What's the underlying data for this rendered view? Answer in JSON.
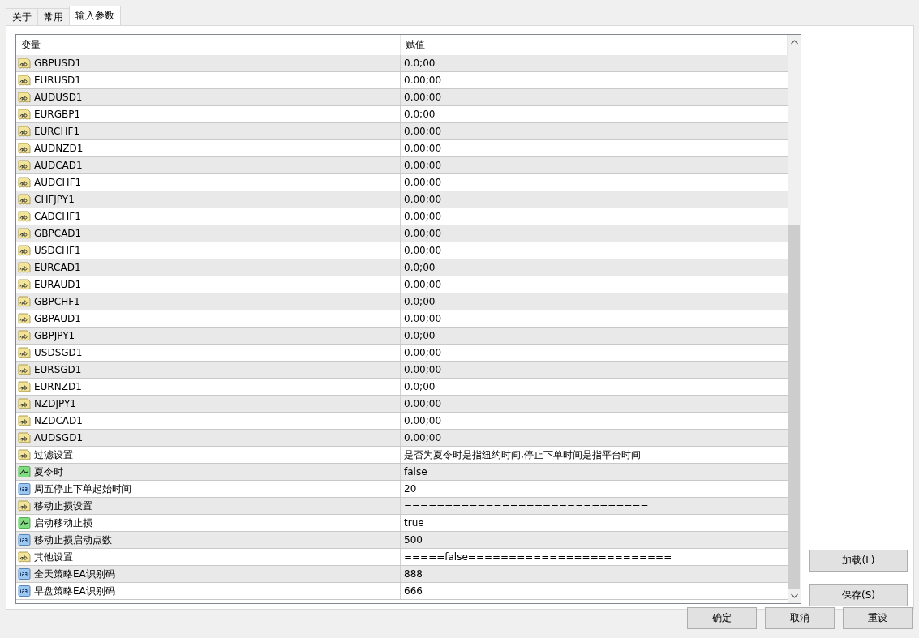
{
  "tabs": [
    {
      "label": "关于",
      "selected": false
    },
    {
      "label": "常用",
      "selected": false
    },
    {
      "label": "输入参数",
      "selected": true
    }
  ],
  "table": {
    "columns": [
      "变量",
      "赋值"
    ],
    "rows": [
      {
        "kind": "string",
        "name": "GBPUSD1",
        "value": "0.0;00"
      },
      {
        "kind": "string",
        "name": "EURUSD1",
        "value": "0.00;00"
      },
      {
        "kind": "string",
        "name": "AUDUSD1",
        "value": "0.00;00"
      },
      {
        "kind": "string",
        "name": "EURGBP1",
        "value": "0.0;00"
      },
      {
        "kind": "string",
        "name": "EURCHF1",
        "value": "0.00;00"
      },
      {
        "kind": "string",
        "name": "AUDNZD1",
        "value": "0.00;00"
      },
      {
        "kind": "string",
        "name": "AUDCAD1",
        "value": "0.00;00"
      },
      {
        "kind": "string",
        "name": "AUDCHF1",
        "value": "0.00;00"
      },
      {
        "kind": "string",
        "name": "CHFJPY1",
        "value": "0.00;00"
      },
      {
        "kind": "string",
        "name": "CADCHF1",
        "value": "0.00;00"
      },
      {
        "kind": "string",
        "name": "GBPCAD1",
        "value": "0.00;00"
      },
      {
        "kind": "string",
        "name": "USDCHF1",
        "value": "0.00;00"
      },
      {
        "kind": "string",
        "name": "EURCAD1",
        "value": "0.0;00"
      },
      {
        "kind": "string",
        "name": "EURAUD1",
        "value": "0.00;00"
      },
      {
        "kind": "string",
        "name": "GBPCHF1",
        "value": "0.0;00"
      },
      {
        "kind": "string",
        "name": "GBPAUD1",
        "value": "0.00;00"
      },
      {
        "kind": "string",
        "name": "GBPJPY1",
        "value": "0.0;00"
      },
      {
        "kind": "string",
        "name": "USDSGD1",
        "value": "0.00;00"
      },
      {
        "kind": "string",
        "name": "EURSGD1",
        "value": "0.00;00"
      },
      {
        "kind": "string",
        "name": "EURNZD1",
        "value": "0.0;00"
      },
      {
        "kind": "string",
        "name": "NZDJPY1",
        "value": "0.00;00"
      },
      {
        "kind": "string",
        "name": "NZDCAD1",
        "value": "0.00;00"
      },
      {
        "kind": "string",
        "name": "AUDSGD1",
        "value": "0.00;00"
      },
      {
        "kind": "string",
        "name": "过滤设置",
        "value": "是否为夏令时是指纽约时间,停止下单时间是指平台时间"
      },
      {
        "kind": "bool",
        "name": "夏令时",
        "value": "false"
      },
      {
        "kind": "int",
        "name": "周五停止下单起始时间",
        "value": "20"
      },
      {
        "kind": "string",
        "name": "移动止损设置",
        "value": "=============================="
      },
      {
        "kind": "bool",
        "name": "启动移动止损",
        "value": "true"
      },
      {
        "kind": "int",
        "name": "移动止损启动点数",
        "value": "500"
      },
      {
        "kind": "string",
        "name": "其他设置",
        "value": "=====false========================="
      },
      {
        "kind": "int",
        "name": "全天策略EA识别码",
        "value": "888"
      },
      {
        "kind": "int",
        "name": "早盘策略EA识别码",
        "value": "666"
      }
    ]
  },
  "side_buttons": [
    "加载(L)",
    "保存(S)"
  ],
  "buttons": [
    "确定",
    "取消",
    "重设"
  ]
}
